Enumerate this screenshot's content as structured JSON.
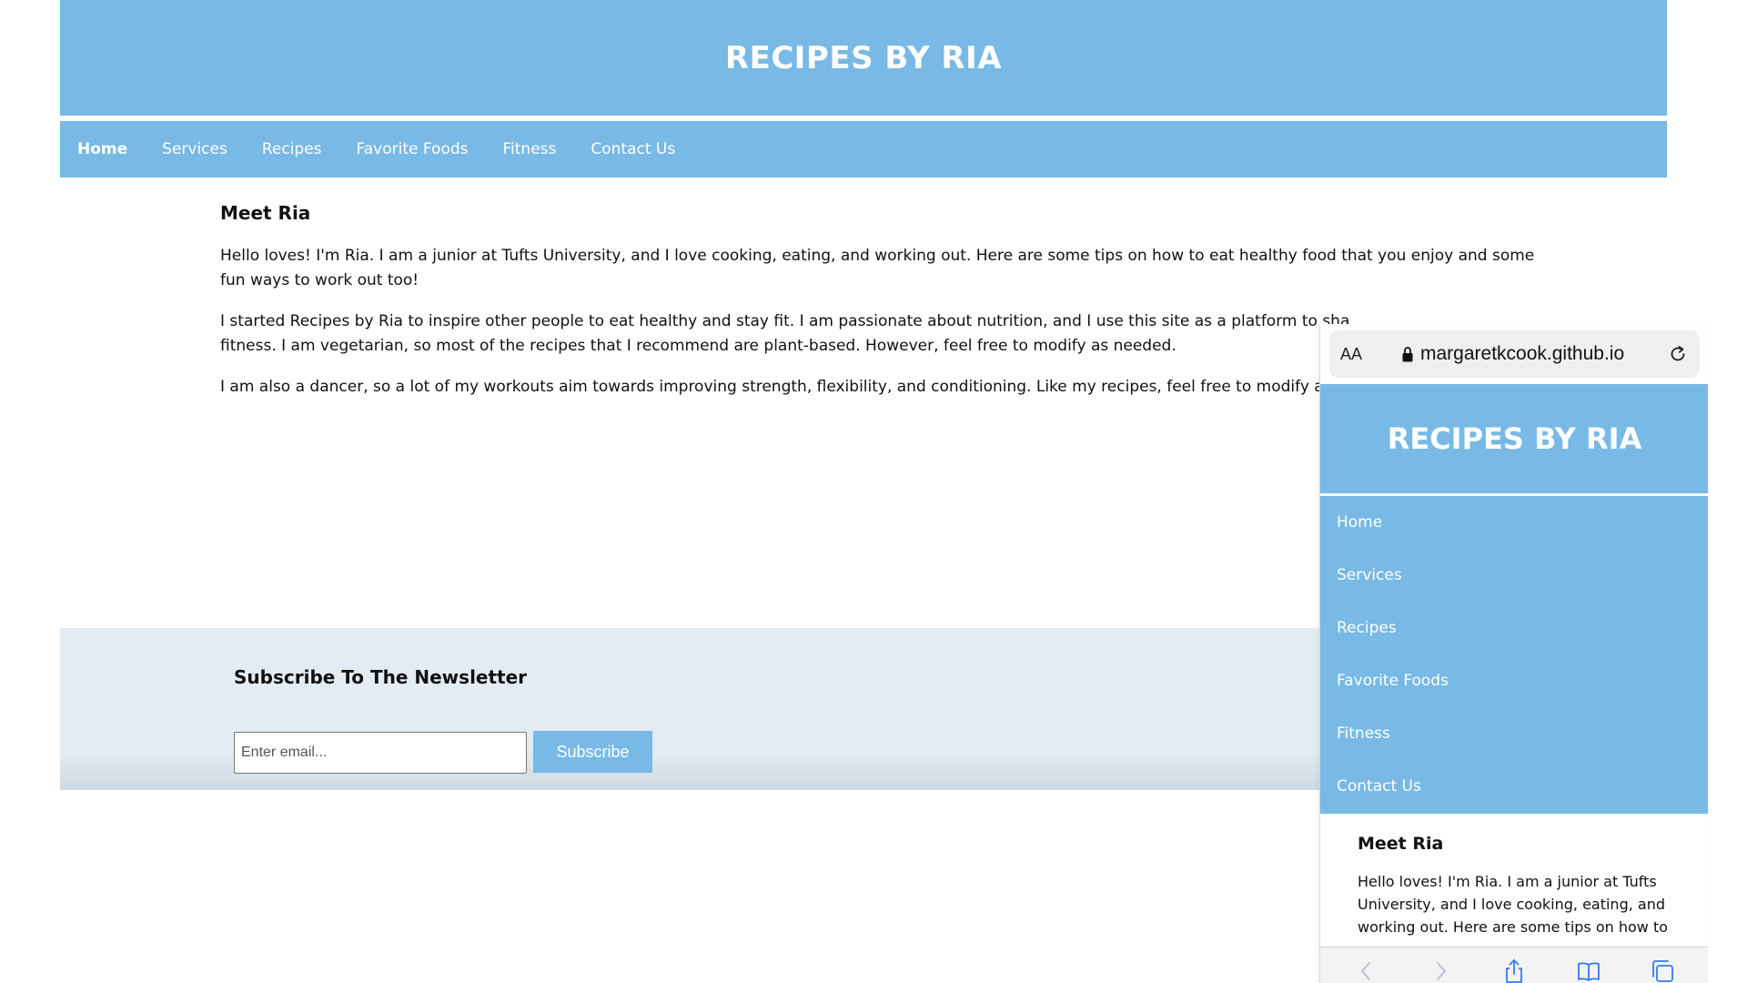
{
  "site": {
    "title": "RECIPES BY RIA",
    "nav": [
      "Home",
      "Services",
      "Recipes",
      "Favorite Foods",
      "Fitness",
      "Contact Us"
    ],
    "active_nav": "Home"
  },
  "content": {
    "heading": "Meet Ria",
    "paragraphs": [
      "Hello loves! I'm Ria. I am a junior at Tufts University, and I love cooking, eating, and working out. Here are some tips on how to eat healthy food that you enjoy and some fun ways to work out too!",
      "I started Recipes by Ria to inspire other people to eat healthy and stay fit. I am passionate about nutrition, and I use this site as a platform to sha",
      "fitness. I am vegetarian, so most of the recipes that I recommend are plant-based. However, feel free to modify as needed.",
      "I am also a dancer, so a lot of my workouts aim towards improving strength, flexibility, and conditioning. Like my recipes, feel free to modify as"
    ]
  },
  "newsletter": {
    "heading": "Subscribe To The Newsletter",
    "email_placeholder": "Enter email...",
    "button_label": "Subscribe"
  },
  "mobile": {
    "aa_label": "AA",
    "url": "margaretkcook.github.io",
    "content_heading": "Meet Ria",
    "content_text": "Hello loves! I'm Ria. I am a junior at Tufts University, and I love cooking, eating, and working out. Here are some tips on how to"
  },
  "colors": {
    "brand_blue": "#78b9e5",
    "newsletter_bg": "#e3ecf3",
    "ios_tint": "#3478f6"
  },
  "icons": {
    "lock": "lock-icon",
    "reload": "reload-icon",
    "back": "back-icon",
    "forward": "forward-icon",
    "share": "share-icon",
    "bookmarks": "bookmarks-icon",
    "tabs": "tabs-icon"
  }
}
